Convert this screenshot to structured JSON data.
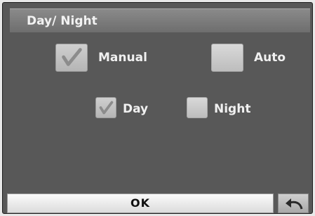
{
  "dialog": {
    "title": "Day/ Night"
  },
  "mode": {
    "manual": {
      "label": "Manual",
      "checked": true
    },
    "auto": {
      "label": "Auto",
      "checked": false
    }
  },
  "manual_options": {
    "day": {
      "label": "Day",
      "checked": true
    },
    "night": {
      "label": "Night",
      "checked": false
    }
  },
  "footer": {
    "ok_label": "OK",
    "back_icon": "return-arrow-icon"
  }
}
